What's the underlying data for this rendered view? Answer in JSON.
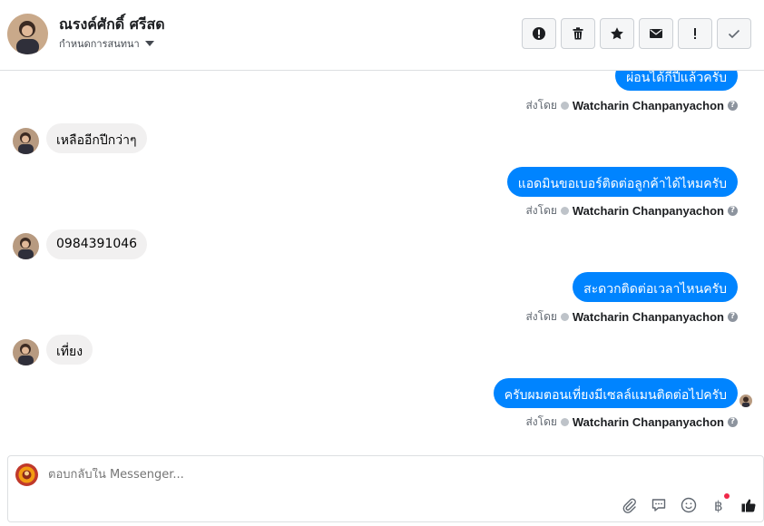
{
  "header": {
    "name": "ณรงค์ศักดิ์ ศรีสด",
    "subtitle": "กำหนดการสนทนา",
    "actions": [
      {
        "icon": "alert-circle-icon"
      },
      {
        "icon": "trash-icon"
      },
      {
        "icon": "star-icon"
      },
      {
        "icon": "envelope-icon"
      },
      {
        "icon": "exclamation-icon"
      },
      {
        "icon": "check-icon"
      }
    ]
  },
  "messages": [
    {
      "direction": "out",
      "text": "ผ่อนได้กี่ปีแล้วครับ"
    },
    {
      "direction": "in",
      "text": "เหลืออีกปีกว่าๆ"
    },
    {
      "direction": "out",
      "text": "แอดมินขอเบอร์ติดต่อลูกค้าได้ไหมครับ"
    },
    {
      "direction": "in",
      "text": "0984391046"
    },
    {
      "direction": "out",
      "text": "สะดวกติดต่อเวลาไหนครับ"
    },
    {
      "direction": "in",
      "text": "เที่ยง"
    },
    {
      "direction": "out",
      "text": "ครับผมตอนเที่ยงมีเซลล์แมนติดต่อไปครับ"
    }
  ],
  "sent_by": {
    "prefix": "ส่งโดย",
    "agent_name": "Watcharin Chanpanyachon",
    "help": "?"
  },
  "composer": {
    "placeholder": "ตอบกลับใน Messenger...",
    "icons": [
      "paperclip-icon",
      "chat-bubble-icon",
      "emoji-icon",
      "baht-icon",
      "thumbs-up-icon"
    ]
  },
  "colors": {
    "accent": "#0084ff",
    "incoming_bubble": "#f1f0f0",
    "notification_dot": "#f02849"
  }
}
